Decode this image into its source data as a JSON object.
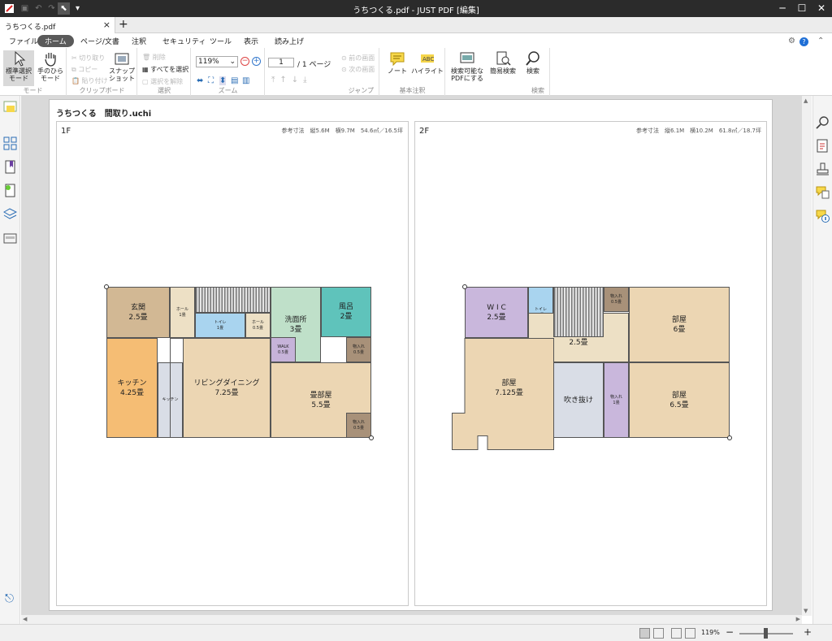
{
  "window": {
    "title": "うちつくる.pdf - JUST PDF [編集]"
  },
  "tab": {
    "label": "うちつくる.pdf",
    "close": "×",
    "new": "+"
  },
  "menu": [
    "ファイル",
    "ホーム",
    "ページ/文書",
    "注釈",
    "セキュリティ",
    "ツール",
    "表示",
    "読み上げ"
  ],
  "ribbon": {
    "mode": {
      "select": "標準選択\nモード",
      "hand": "手のひら\nモード",
      "label": "モード"
    },
    "clipboard": {
      "cut": "切り取り",
      "copy": "コピー",
      "paste": "貼り付け",
      "snapshot": "スナップ\nショット",
      "label": "クリップボード"
    },
    "selection": {
      "delete": "削除",
      "select_all": "すべてを選択",
      "deselect": "選択を解除",
      "label": "選択"
    },
    "zoom": {
      "value": "119%",
      "label": "ズーム"
    },
    "jump": {
      "page": "1",
      "total": "/ 1 ページ",
      "prev": "前の画面",
      "next": "次の画面",
      "label": "ジャンプ"
    },
    "annot": {
      "note": "ノート",
      "highlight": "ハイライト",
      "label": "基本注釈"
    },
    "search": {
      "searchable": "検索可能な\nPDFにする",
      "simple": "簡易検索",
      "search": "検索",
      "label": "検索"
    }
  },
  "document": {
    "title": "うちつくる　間取り.uchi",
    "floor1": {
      "name": "1F",
      "info": "参考寸法　縦5.6M　横9.7M　54.6㎡／16.5坪",
      "rooms": {
        "genkan": "玄関\n2.5畳",
        "hall1": "ホール\n1畳",
        "toilet": "トイレ\n1畳",
        "hall2": "ホール\n0.5畳",
        "senmen": "洗面所\n3畳",
        "furo": "風呂\n2畳",
        "walk": "WALK\n0.5畳",
        "osh1": "物入れ\n0.5畳",
        "kitchen": "キッチン\n4.25畳",
        "kcounter": "キッチン",
        "ld": "リビングダイニング\n7.25畳",
        "tatami": "畳部屋\n5.5畳",
        "osh2": "物入れ\n0.5畳"
      }
    },
    "floor2": {
      "name": "2F",
      "info": "参考寸法　縦6.1M　横10.2M　61.8㎡／18.7坪",
      "rooms": {
        "wic": "W I C\n2.5畳",
        "toilet": "トイレ\n1畳",
        "osh1": "物入れ\n0.5畳",
        "room6": "部屋\n6畳",
        "rouka": "廊下\n2.5畳",
        "room7": "部屋\n7.125畳",
        "fukinuke": "吹き抜け",
        "osh2": "物入れ\n1畳",
        "room65": "部屋\n6.5畳"
      }
    }
  },
  "status": {
    "zoom": "119%",
    "minus": "−",
    "plus": "+"
  },
  "colors": {
    "genkan": "#d2b894",
    "hall": "#ede0c5",
    "toilet": "#a9d4ef",
    "senmen": "#bfe0c9",
    "furo": "#5fc3bb",
    "walk": "#c6b3d9",
    "storage": "#a89179",
    "kitchen": "#f5bd74",
    "counter": "#d9dde6",
    "living": "#ecd6b3",
    "wic": "#c9b7dc",
    "fukinuke": "#d9dde6"
  }
}
